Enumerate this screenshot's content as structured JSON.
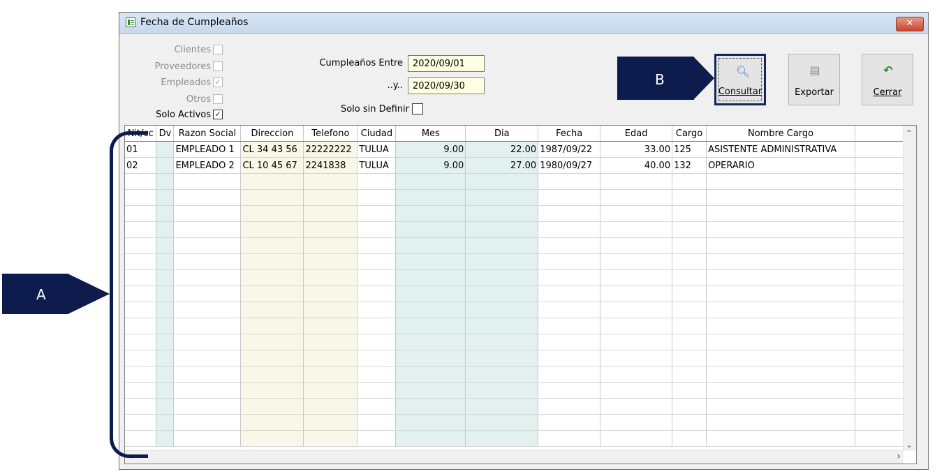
{
  "window": {
    "title": "Fecha de Cumpleaños",
    "close_label": "✕"
  },
  "filters": {
    "clientes": "Clientes",
    "proveedores": "Proveedores",
    "empleados": "Empleados",
    "otros": "Otros",
    "solo_activos": "Solo Activos",
    "checked_mark": "✓",
    "birthday_between_label": "Cumpleaños Entre",
    "and_label": "..y..",
    "date_from": "2020/09/01",
    "date_to": "2020/09/30",
    "solo_sin_definir": "Solo sin Definir"
  },
  "toolbar": {
    "consultar": "Consultar",
    "exportar": "Exportar",
    "cerrar": "Cerrar"
  },
  "grid": {
    "columns": [
      "Nit/cc",
      "Dv",
      "Razon Social",
      "Direccion",
      "Telefono",
      "Ciudad",
      "Mes",
      "Dia",
      "Fecha",
      "Edad",
      "Cargo",
      "Nombre Cargo"
    ],
    "rows": [
      [
        "01",
        "",
        "EMPLEADO 1",
        "CL 34 43 56",
        "22222222",
        "TULUA",
        "9.00",
        "22.00",
        "1987/09/22",
        "33.00",
        "125",
        "ASISTENTE ADMINISTRATIVA"
      ],
      [
        "02",
        "",
        "EMPLEADO 2",
        "CL 10 45 67",
        "2241838",
        "TULUA",
        "9.00",
        "27.00",
        "1980/09/27",
        "40.00",
        "132",
        "OPERARIO"
      ]
    ]
  },
  "annotations": {
    "a": "A",
    "b": "B"
  },
  "colors": {
    "annotation": "#0d1b4d",
    "date_bg": "#ffffe1"
  }
}
